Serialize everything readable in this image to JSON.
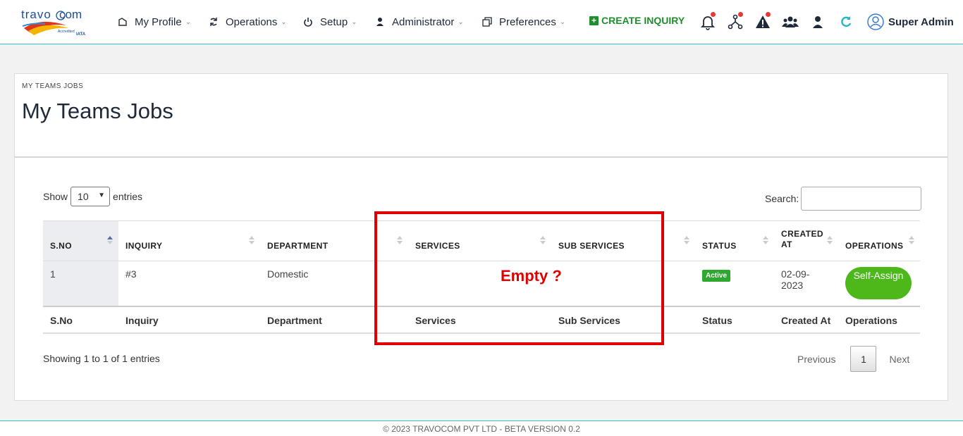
{
  "header": {
    "logo_text": "travocom",
    "nav": [
      {
        "label": "My Profile",
        "icon": "chart-icon"
      },
      {
        "label": "Operations",
        "icon": "sync-icon"
      },
      {
        "label": "Setup",
        "icon": "power-icon"
      },
      {
        "label": "Administrator",
        "icon": "person-icon"
      },
      {
        "label": "Preferences",
        "icon": "copy-icon"
      }
    ],
    "create_inquiry": "CREATE INQUIRY",
    "icons": [
      "bell-icon",
      "network-icon",
      "warning-icon",
      "users-icon",
      "user-icon",
      "refresh-icon"
    ],
    "user_name": "Super Admin"
  },
  "page": {
    "breadcrumb": "MY TEAMS JOBS",
    "title": "My Teams Jobs"
  },
  "table_controls": {
    "show_label": "Show",
    "entries_value": "10",
    "entries_label": "entries",
    "search_label": "Search:",
    "search_value": ""
  },
  "table": {
    "headers": [
      "S.NO",
      "INQUIRY",
      "DEPARTMENT",
      "SERVICES",
      "SUB SERVICES",
      "STATUS",
      "CREATED AT",
      "OPERATIONS"
    ],
    "rows": [
      {
        "sno": "1",
        "inquiry": "#3",
        "department": "Domestic",
        "services": "",
        "sub_services": "",
        "status": "Active",
        "created_at": "02-09-2023",
        "operation": "Self-Assign"
      }
    ],
    "footers": [
      "S.No",
      "Inquiry",
      "Department",
      "Services",
      "Sub Services",
      "Status",
      "Created At",
      "Operations"
    ]
  },
  "info": "Showing 1 to 1 of 1 entries",
  "pagination": {
    "previous": "Previous",
    "page": "1",
    "next": "Next"
  },
  "annotation": "Empty ?",
  "footer": "© 2023 TRAVOCOM PVT LTD - BETA VERSION 0.2",
  "colors": {
    "accent": "#3fb6c8",
    "green": "#4cb81a",
    "red_annotation": "#e00000"
  }
}
